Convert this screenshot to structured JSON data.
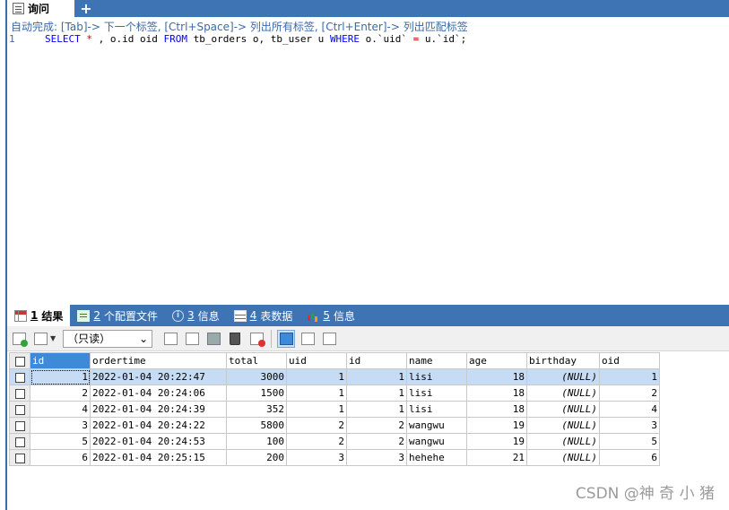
{
  "editor": {
    "tab_label": "询问",
    "add_tab": "+",
    "hint": "自动完成: [Tab]-> 下一个标签, [Ctrl+Space]-> 列出所有标签, [Ctrl+Enter]-> 列出匹配标签",
    "line_number": "1",
    "sql": {
      "kw_select": "SELECT",
      "star": " * ",
      "p1": ", o.id oid ",
      "kw_from": "FROM",
      "p2": " tb_orders o, tb_user u ",
      "kw_where": "WHERE",
      "p3": " o.`uid` ",
      "eq": "=",
      "p4": " u.`id`;"
    }
  },
  "result_tabs": [
    {
      "num": "1",
      "label": "结果",
      "icon": "grid-icon"
    },
    {
      "num": "2",
      "label": "个配置文件",
      "icon": "profile-icon"
    },
    {
      "num": "3",
      "label": "信息",
      "icon": "info-icon"
    },
    {
      "num": "4",
      "label": "表数据",
      "icon": "table-icon"
    },
    {
      "num": "5",
      "label": "信息",
      "icon": "chart-icon"
    }
  ],
  "toolbar": {
    "mode_value": "（只读）",
    "info_glyph": "i"
  },
  "grid": {
    "columns": [
      "id",
      "ordertime",
      "total",
      "uid",
      "id",
      "name",
      "age",
      "birthday",
      "oid"
    ],
    "rows": [
      [
        "1",
        "2022-01-04 20:22:47",
        "3000",
        "1",
        "1",
        "lisi",
        "18",
        "(NULL)",
        "1"
      ],
      [
        "2",
        "2022-01-04 20:24:06",
        "1500",
        "1",
        "1",
        "lisi",
        "18",
        "(NULL)",
        "2"
      ],
      [
        "4",
        "2022-01-04 20:24:39",
        "352",
        "1",
        "1",
        "lisi",
        "18",
        "(NULL)",
        "4"
      ],
      [
        "3",
        "2022-01-04 20:24:22",
        "5800",
        "2",
        "2",
        "wangwu",
        "19",
        "(NULL)",
        "3"
      ],
      [
        "5",
        "2022-01-04 20:24:53",
        "100",
        "2",
        "2",
        "wangwu",
        "19",
        "(NULL)",
        "5"
      ],
      [
        "6",
        "2022-01-04 20:25:15",
        "200",
        "3",
        "3",
        "hehehe",
        "21",
        "(NULL)",
        "6"
      ]
    ]
  },
  "watermark": "CSDN @神 奇 小 猪"
}
